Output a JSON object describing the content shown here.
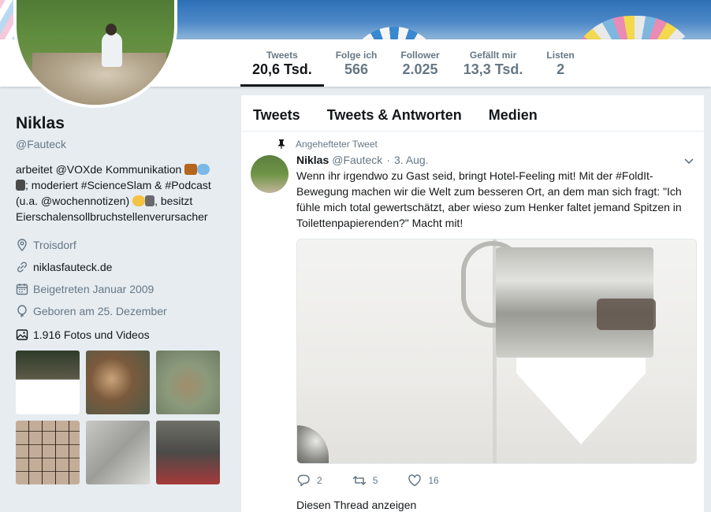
{
  "stats": [
    {
      "label": "Tweets",
      "value": "20,6 Tsd."
    },
    {
      "label": "Folge ich",
      "value": "566"
    },
    {
      "label": "Follower",
      "value": "2.025"
    },
    {
      "label": "Gefällt mir",
      "value": "13,3 Tsd."
    },
    {
      "label": "Listen",
      "value": "2"
    }
  ],
  "profile": {
    "name": "Niklas",
    "handle": "@Fauteck",
    "bio_line1": "arbeitet @VOXde Kommunikation",
    "bio_line2": "; moderiert #ScienceSlam & #Podcast",
    "bio_line3": "(u.a. @wochennotizen)",
    "bio_line3b": ", besitzt",
    "bio_line4": "Eierschalensollbruchstellenverursacher",
    "location": "Troisdorf",
    "website": "niklasfauteck.de",
    "joined": "Beigetreten Januar 2009",
    "birthday": "Geboren am 25. Dezember",
    "photos": "1.916 Fotos und Videos"
  },
  "tabs": [
    "Tweets",
    "Tweets & Antworten",
    "Medien"
  ],
  "tweet": {
    "pinned_label": "Angehefteter Tweet",
    "name": "Niklas",
    "handle": "@Fauteck",
    "dot": "·",
    "date": "3. Aug.",
    "text": "Wenn ihr irgendwo zu Gast seid, bringt Hotel-Feeling mit! Mit der #FoldIt-Bewegung machen wir die Welt zum besseren Ort, an dem man sich fragt: \"Ich fühle mich total gewertschätzt, aber wieso zum Henker faltet jemand Spitzen in Toilettenpapierenden?\" Macht mit!",
    "replies": "2",
    "retweets": "5",
    "likes": "16",
    "thread_link": "Diesen Thread anzeigen"
  },
  "colors": {
    "accent": "#1da1f2",
    "text": "#14171a",
    "muted": "#657786",
    "bg": "#e6ecf0"
  }
}
